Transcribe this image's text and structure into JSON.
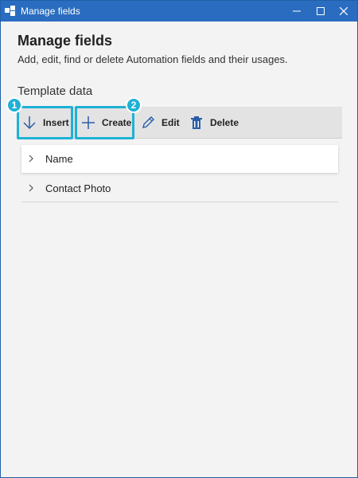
{
  "window": {
    "title": "Manage fields",
    "controls": {
      "minimize": "minimize",
      "maximize": "maximize",
      "close": "close"
    }
  },
  "header": {
    "title": "Manage fields",
    "subtitle": "Add, edit, find or delete Automation fields and their usages."
  },
  "section": {
    "label": "Template data"
  },
  "toolbar": {
    "insert_label": "Insert",
    "create_label": "Create",
    "edit_label": "Edit",
    "delete_label": "Delete"
  },
  "callouts": {
    "first": "1",
    "second": "2"
  },
  "fields": [
    {
      "label": "Name",
      "selected": true
    },
    {
      "label": "Contact Photo",
      "selected": false
    }
  ],
  "colors": {
    "titlebar": "#2a6dc0",
    "highlight": "#1fb1d6",
    "icon_blue": "#2a5ca8"
  }
}
